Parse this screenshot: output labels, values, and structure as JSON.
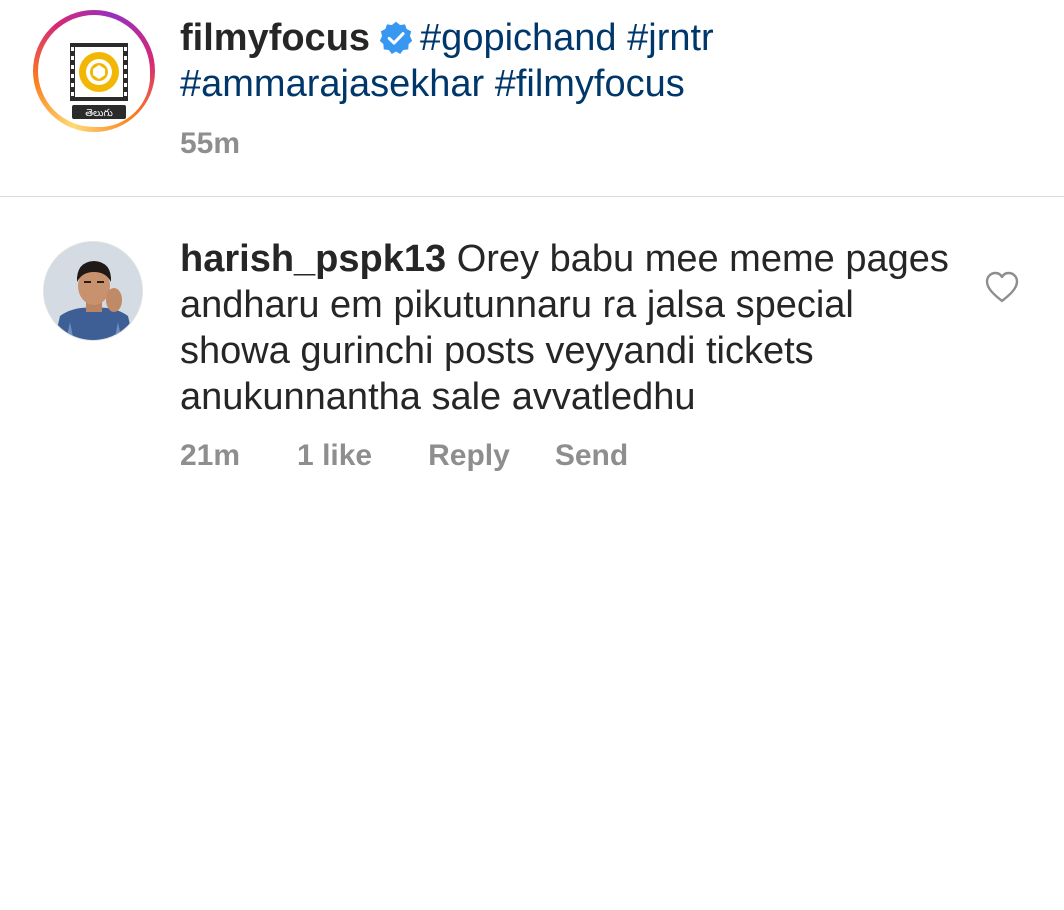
{
  "caption": {
    "username": "filmyfocus",
    "verified": true,
    "hashtags": [
      "#gopichand",
      "#jrntr",
      "#ammarajasekhar",
      "#filmyfocus"
    ],
    "time": "55m",
    "avatar_label": "తెలుగు"
  },
  "comment": {
    "username": "harish_pspk13",
    "text": "Orey babu mee meme pages andharu em pikutunnaru ra jalsa special showa gurinchi posts veyyandi tickets anukunnantha sale avvatledhu",
    "time": "21m",
    "likes": "1 like",
    "reply_label": "Reply",
    "send_label": "Send"
  },
  "icons": {
    "verified": "verified-badge-icon",
    "like": "heart-outline-icon"
  },
  "colors": {
    "hashtag": "#00376b",
    "verified": "#3897f0",
    "meta_text": "#8e8e8e",
    "primary_text": "#262626",
    "film_gold": "#f2b705"
  }
}
